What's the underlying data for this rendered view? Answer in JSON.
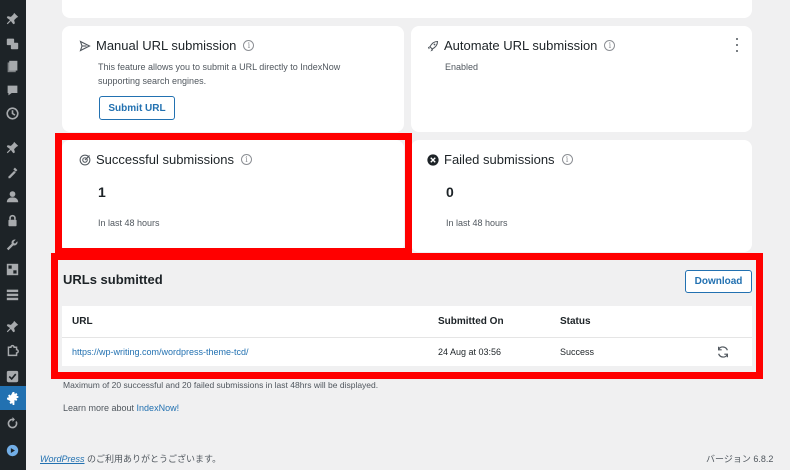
{
  "sidebar": {
    "icons": [
      "pin-icon",
      "media-icon",
      "pages-icon",
      "comments-icon",
      "appearance-icon",
      "plugins-icon",
      "tools-icon",
      "users-icon",
      "lock-icon",
      "wrench-icon",
      "grid-icon",
      "list-icon",
      "pin-icon-2",
      "puzzle-icon",
      "check-icon",
      "settings-icon",
      "refresh-icon",
      "play-icon"
    ]
  },
  "manual": {
    "title": "Manual URL submission",
    "description": "This feature allows you to submit a URL directly to IndexNow supporting search engines.",
    "button_label": "Submit URL"
  },
  "automate": {
    "title": "Automate URL submission",
    "status": "Enabled"
  },
  "successful": {
    "title": "Successful submissions",
    "count": "1",
    "period": "In last 48 hours"
  },
  "failed": {
    "title": "Failed submissions",
    "count": "0",
    "period": "In last 48 hours"
  },
  "urls": {
    "title": "URLs submitted",
    "download_label": "Download",
    "columns": {
      "url": "URL",
      "submitted_on": "Submitted On",
      "status": "Status"
    },
    "rows": [
      {
        "url": "https://wp-writing.com/wordpress-theme-tcd/",
        "submitted_on": "24 Aug at 03:56",
        "status": "Success"
      }
    ],
    "note": "Maximum of 20 successful and 20 failed submissions in last 48hrs will be displayed.",
    "learn_more_prefix": "Learn more about ",
    "learn_more_link": "IndexNow!"
  },
  "footer": {
    "wp_link": "WordPress",
    "thanks": " のご利用ありがとうございます。",
    "version": "バージョン 6.8.2"
  },
  "colors": {
    "accent": "#2271b1",
    "highlight": "#ff0000",
    "adminbar": "#1d2327"
  }
}
